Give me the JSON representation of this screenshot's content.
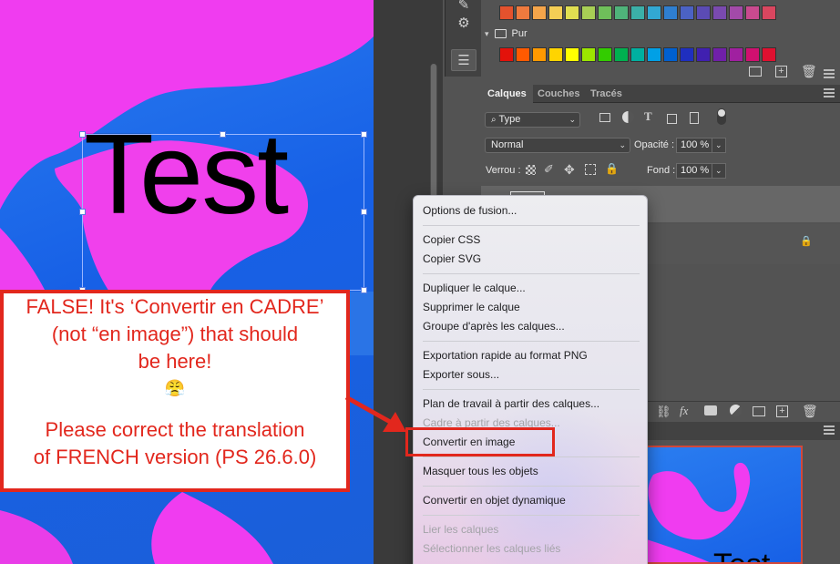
{
  "swatches": {
    "row1": [
      "#e4522d",
      "#ef7a3e",
      "#f5a54a",
      "#f5ce55",
      "#e0de51",
      "#a8cf55",
      "#6fbf5a",
      "#4fb37a",
      "#3bb0a8",
      "#32a8d3",
      "#2f7fd0",
      "#4b62c4",
      "#5b4bb5",
      "#7a4aaf",
      "#a34aa9",
      "#c94a8f",
      "#d9465f"
    ],
    "row2": [
      "#e3120b",
      "#ff5a00",
      "#ff9900",
      "#ffd400",
      "#ffff00",
      "#9ce600",
      "#33cc00",
      "#00b050",
      "#00b0a0",
      "#00a0e6",
      "#0060d0",
      "#1f2fbf",
      "#4020b0",
      "#7020a8",
      "#a020a0",
      "#d01070",
      "#e01030"
    ],
    "group_label": "Pur"
  },
  "layers": {
    "tabs": [
      {
        "label": "Calques",
        "active": true
      },
      {
        "label": "Couches",
        "active": false
      },
      {
        "label": "Tracés",
        "active": false
      }
    ],
    "filter": {
      "label": "Type"
    },
    "blend_mode": "Normal",
    "opacity_label": "Opacité :",
    "opacity_value": "100 %",
    "lock_label": "Verrou :",
    "fill_label": "Fond :",
    "fill_value": "100 %"
  },
  "canvas": {
    "text": "Test"
  },
  "navigator": {
    "text": "Test"
  },
  "context_menu": {
    "items": [
      {
        "label": "Options de fusion...",
        "disabled": false
      },
      {
        "label": "Copier CSS",
        "disabled": false
      },
      {
        "label": "Copier SVG",
        "disabled": false
      },
      {
        "label": "Dupliquer le calque...",
        "disabled": false
      },
      {
        "label": "Supprimer le calque",
        "disabled": false
      },
      {
        "label": "Groupe d'après les calques...",
        "disabled": false
      },
      {
        "label": "Exportation rapide au format PNG",
        "disabled": false
      },
      {
        "label": "Exporter sous...",
        "disabled": false
      },
      {
        "label": "Plan de travail à partir des calques...",
        "disabled": false
      },
      {
        "label": "Cadre à partir des calques...",
        "disabled": true
      },
      {
        "label": "Convertir en image",
        "disabled": false
      },
      {
        "label": "Masquer tous les objets",
        "disabled": false
      },
      {
        "label": "Convertir en objet dynamique",
        "disabled": false
      },
      {
        "label": "Lier les calques",
        "disabled": true
      },
      {
        "label": "Sélectionner les calques liés",
        "disabled": true
      }
    ]
  },
  "annotation": {
    "line1": "FALSE! It's ‘Convertir en CADRE’",
    "line2": "(not “en image”) that should",
    "line3": "be here!",
    "emoji": "😤",
    "line4": "Please correct the translation",
    "line5": "of FRENCH version (PS 26.6.0)"
  },
  "colors": {
    "accent_red": "#e2271d",
    "canvas_blue": "#1f6be8",
    "canvas_pink": "#f03cf0"
  }
}
